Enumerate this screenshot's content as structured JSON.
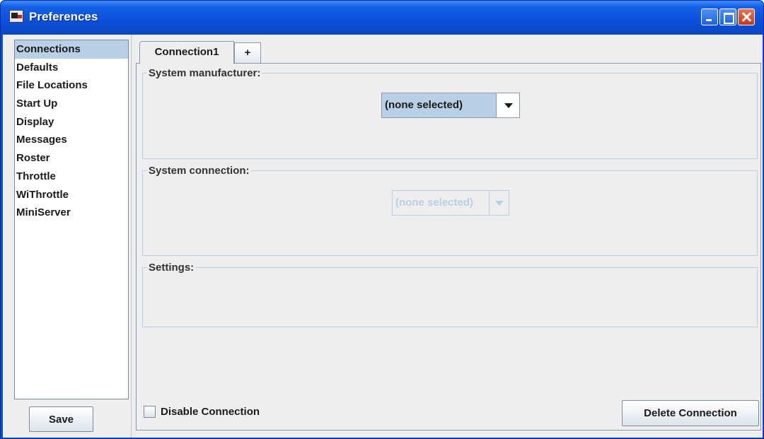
{
  "window": {
    "title": "Preferences",
    "controls": {
      "minimize_icon": "minimize-icon",
      "maximize_icon": "maximize-icon",
      "close_icon": "close-icon"
    }
  },
  "sidebar": {
    "items": [
      {
        "label": "Connections",
        "selected": true
      },
      {
        "label": "Defaults",
        "selected": false
      },
      {
        "label": "File Locations",
        "selected": false
      },
      {
        "label": "Start Up",
        "selected": false
      },
      {
        "label": "Display",
        "selected": false
      },
      {
        "label": "Messages",
        "selected": false
      },
      {
        "label": "Roster",
        "selected": false
      },
      {
        "label": "Throttle",
        "selected": false
      },
      {
        "label": "WiThrottle",
        "selected": false
      },
      {
        "label": "MiniServer",
        "selected": false
      }
    ],
    "save_label": "Save"
  },
  "tabs": [
    {
      "label": "Connection1",
      "active": true
    },
    {
      "label": "+",
      "active": false
    }
  ],
  "panel": {
    "manufacturer": {
      "label": "System manufacturer:",
      "value": "(none selected)",
      "enabled": true
    },
    "connection": {
      "label": "System connection:",
      "value": "(none selected)",
      "enabled": false
    },
    "settings": {
      "label": "Settings:"
    },
    "disable_label": "Disable Connection",
    "disable_checked": false,
    "delete_label": "Delete Connection"
  },
  "colors": {
    "titlebar": "#0a4fd8",
    "selection": "#b8cfe5",
    "background": "#eeeeee"
  }
}
